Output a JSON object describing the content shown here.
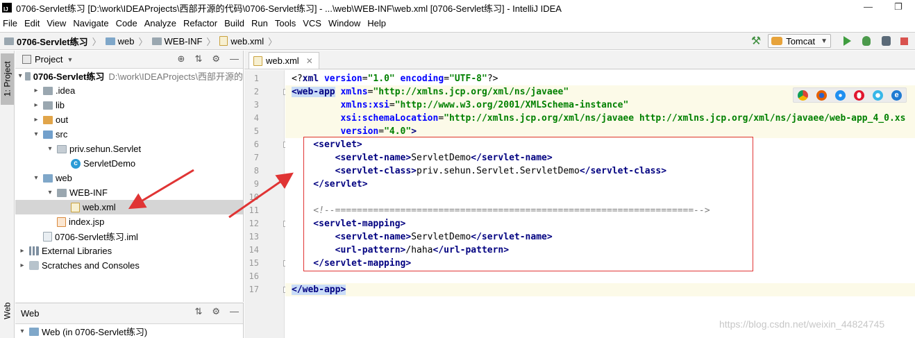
{
  "window": {
    "title": "0706-Servlet练习 [D:\\work\\IDEAProjects\\西部开源的代码\\0706-Servlet练习] - ...\\web\\WEB-INF\\web.xml [0706-Servlet练习] - IntelliJ IDEA",
    "app_icon_label": "IJ",
    "minimize": "—",
    "maximize": "❐"
  },
  "menu": [
    "File",
    "Edit",
    "View",
    "Navigate",
    "Code",
    "Analyze",
    "Refactor",
    "Build",
    "Run",
    "Tools",
    "VCS",
    "Window",
    "Help"
  ],
  "breadcrumb": [
    "0706-Servlet练习",
    "web",
    "WEB-INF",
    "web.xml"
  ],
  "run_config": {
    "label": "Tomcat"
  },
  "left_strip": {
    "project_tab": "1: Project",
    "web_tab": "Web"
  },
  "project_panel": {
    "title": "Project",
    "tree": [
      {
        "label": "0706-Servlet练习",
        "path": "D:\\work\\IDEAProjects\\西部开源的",
        "indent": 0,
        "icon": "folder-icon",
        "arrow": "▾"
      },
      {
        "label": ".idea",
        "indent": 1,
        "icon": "folder-icon",
        "arrow": "▸"
      },
      {
        "label": "lib",
        "indent": 1,
        "icon": "folder-icon",
        "arrow": "▸"
      },
      {
        "label": "out",
        "indent": 1,
        "icon": "folder-orange-icon",
        "arrow": "▸"
      },
      {
        "label": "src",
        "indent": 1,
        "icon": "source-folder-icon",
        "arrow": "▾"
      },
      {
        "label": "priv.sehun.Servlet",
        "indent": 2,
        "icon": "package-icon",
        "arrow": "▾"
      },
      {
        "label": "ServletDemo",
        "indent": 3,
        "icon": "class-icon",
        "arrow": ""
      },
      {
        "label": "web",
        "indent": 1,
        "icon": "web-folder-icon",
        "arrow": "▾"
      },
      {
        "label": "WEB-INF",
        "indent": 2,
        "icon": "folder-icon",
        "arrow": "▾"
      },
      {
        "label": "web.xml",
        "indent": 3,
        "icon": "xml-file-icon",
        "arrow": "",
        "selected": true
      },
      {
        "label": "index.jsp",
        "indent": 2,
        "icon": "jsp-file-icon",
        "arrow": ""
      },
      {
        "label": "0706-Servlet练习.iml",
        "indent": 1,
        "icon": "iml-file-icon",
        "arrow": ""
      },
      {
        "label": "External Libraries",
        "indent": 0,
        "icon": "libraries-icon",
        "arrow": "▸"
      },
      {
        "label": "Scratches and Consoles",
        "indent": 0,
        "icon": "scratches-icon",
        "arrow": "▸"
      }
    ]
  },
  "web_panel": {
    "title": "Web",
    "item": "Web (in 0706-Servlet练习)"
  },
  "editor": {
    "tab_label": "web.xml",
    "line_numbers": [
      "1",
      "2",
      "3",
      "4",
      "5",
      "6",
      "7",
      "8",
      "9",
      "10",
      "11",
      "12",
      "13",
      "14",
      "15",
      "16",
      "17"
    ],
    "lines": {
      "l1": {
        "a": "<?",
        "b": "xml",
        "c": " version",
        "d": "=",
        "e": "\"1.0\"",
        "f": " encoding",
        "g": "=",
        "h": "\"UTF-8\"",
        "i": "?>"
      },
      "l2": {
        "tag": "<web-app",
        "attr": " xmlns",
        "eq": "=",
        "str": "\"http://xmlns.jcp.org/xml/ns/javaee\""
      },
      "l3": {
        "attr": "         xmlns:xsi",
        "eq": "=",
        "str": "\"http://www.w3.org/2001/XMLSchema-instance\""
      },
      "l4": {
        "attr": "         xsi:schemaLocation",
        "eq": "=",
        "str": "\"http://xmlns.jcp.org/xml/ns/javaee http://xmlns.jcp.org/xml/ns/javaee/web-app_4_0.xs"
      },
      "l5": {
        "attr": "         version",
        "eq": "=",
        "str": "\"4.0\"",
        "end": ">"
      },
      "l6": {
        "tag": "    <servlet>"
      },
      "l7": {
        "open": "        <servlet-name>",
        "text": "ServletDemo",
        "close": "</servlet-name>"
      },
      "l8": {
        "open": "        <servlet-class>",
        "text": "priv.sehun.Servlet.ServletDemo",
        "close": "</servlet-class>"
      },
      "l9": {
        "tag": "    </servlet>"
      },
      "l11": {
        "cmt": "    <!--==================================================================-->"
      },
      "l12": {
        "tag": "    <servlet-mapping>"
      },
      "l13": {
        "open": "        <servlet-name>",
        "text": "ServletDemo",
        "close": "</servlet-name>"
      },
      "l14": {
        "open": "        <url-pattern>",
        "text": "/haha",
        "close": "</url-pattern>"
      },
      "l15": {
        "tag": "    </servlet-mapping>"
      },
      "l17": {
        "tag": "</web-app>"
      }
    }
  },
  "browser_icons": [
    "chrome-icon",
    "firefox-icon",
    "safari-icon",
    "opera-icon",
    "ie-icon",
    "edge-icon"
  ],
  "colors": {
    "annotation_red": "#e03434",
    "xml_tag": "#000080",
    "xml_attr": "#0000ff",
    "xml_string": "#008000",
    "current_line": "#fcfae8",
    "tree_selection": "#d5d5d5"
  },
  "watermark": "https://blog.csdn.net/weixin_44824745"
}
